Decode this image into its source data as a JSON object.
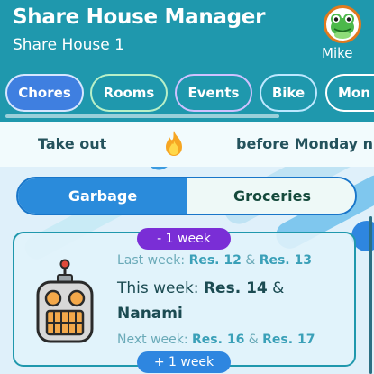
{
  "header": {
    "title": "Share House Manager",
    "house_name": "Share House 1",
    "user": {
      "name": "Mike",
      "avatar": "frog-avatar-icon"
    }
  },
  "tabs": [
    {
      "label": "Chores",
      "selected": true
    },
    {
      "label": "Rooms"
    },
    {
      "label": "Events"
    },
    {
      "label": "Bike"
    },
    {
      "label": "Mon"
    }
  ],
  "ticker": {
    "item1": "Take out",
    "icon": "fire-icon",
    "item2": "before Monday n"
  },
  "segments": [
    {
      "label": "Garbage",
      "selected": true
    },
    {
      "label": "Groceries"
    }
  ],
  "schedule": {
    "prev_week_label": "- 1 week",
    "next_week_label": "+ 1 week",
    "last_week": {
      "prefix": "Last week:",
      "res1": "Res. 12",
      "sep": "&",
      "res2": "Res. 13"
    },
    "this_week": {
      "prefix": "This week:",
      "res1": "Res. 14",
      "sep": "&",
      "name": "Nanami"
    },
    "next_week": {
      "prefix": "Next week:",
      "res1": "Res. 16",
      "sep": "&",
      "res2": "Res. 17"
    }
  },
  "colors": {
    "header": "#1f98ad",
    "tab_selected": "#3f7fe0",
    "segment_selected": "#2a8bdb",
    "prev_pill": "#7a2ed6",
    "next_pill": "#2e86e0"
  }
}
